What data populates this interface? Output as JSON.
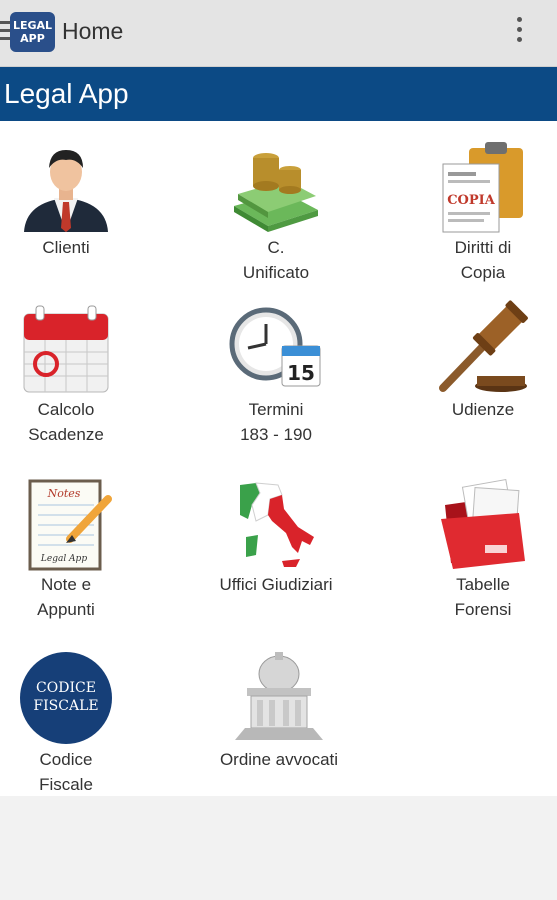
{
  "appbar": {
    "logo_line1": "LEGAL",
    "logo_line2": "APP",
    "title": "Home"
  },
  "banner": {
    "title": "Legal App"
  },
  "tiles": [
    {
      "line1": "Clienti",
      "line2": ""
    },
    {
      "line1": "C.",
      "line2": "Unificato"
    },
    {
      "line1": "Diritti di",
      "line2": "Copia",
      "doc_text": "COPIA"
    },
    {
      "line1": "Calcolo",
      "line2": "Scadenze"
    },
    {
      "line1": "Termini",
      "line2": "183 - 190",
      "calendar_day": "15"
    },
    {
      "line1": "Udienze",
      "line2": ""
    },
    {
      "line1": "Note e",
      "line2": "Appunti",
      "notebook_title": "Notes",
      "notebook_sign": "Legal App"
    },
    {
      "line1": "Uffici Giudiziari",
      "line2": ""
    },
    {
      "line1": "Tabelle",
      "line2": "Forensi"
    },
    {
      "line1": "Codice",
      "line2": "Fiscale",
      "badge_line1": "CODICE",
      "badge_line2": "FISCALE"
    },
    {
      "line1": "Ordine avvocati",
      "line2": ""
    }
  ],
  "colors": {
    "banner": "#0c4a85",
    "appbar": "#e4e4e4",
    "logo": "#2a4f8a"
  }
}
